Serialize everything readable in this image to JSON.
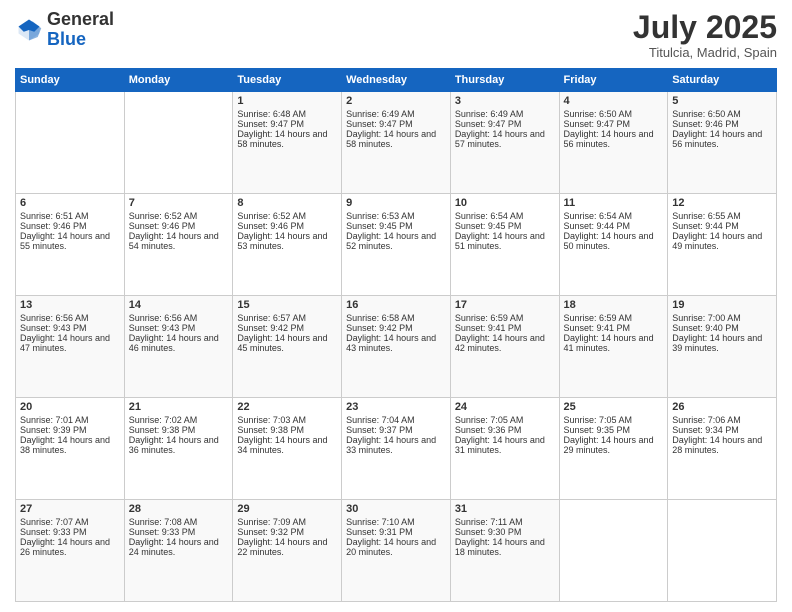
{
  "header": {
    "logo_general": "General",
    "logo_blue": "Blue",
    "month": "July 2025",
    "location": "Titulcia, Madrid, Spain"
  },
  "weekdays": [
    "Sunday",
    "Monday",
    "Tuesday",
    "Wednesday",
    "Thursday",
    "Friday",
    "Saturday"
  ],
  "weeks": [
    [
      {
        "day": "",
        "info": ""
      },
      {
        "day": "",
        "info": ""
      },
      {
        "day": "1",
        "info": "Sunrise: 6:48 AM\nSunset: 9:47 PM\nDaylight: 14 hours and 58 minutes."
      },
      {
        "day": "2",
        "info": "Sunrise: 6:49 AM\nSunset: 9:47 PM\nDaylight: 14 hours and 58 minutes."
      },
      {
        "day": "3",
        "info": "Sunrise: 6:49 AM\nSunset: 9:47 PM\nDaylight: 14 hours and 57 minutes."
      },
      {
        "day": "4",
        "info": "Sunrise: 6:50 AM\nSunset: 9:47 PM\nDaylight: 14 hours and 56 minutes."
      },
      {
        "day": "5",
        "info": "Sunrise: 6:50 AM\nSunset: 9:46 PM\nDaylight: 14 hours and 56 minutes."
      }
    ],
    [
      {
        "day": "6",
        "info": "Sunrise: 6:51 AM\nSunset: 9:46 PM\nDaylight: 14 hours and 55 minutes."
      },
      {
        "day": "7",
        "info": "Sunrise: 6:52 AM\nSunset: 9:46 PM\nDaylight: 14 hours and 54 minutes."
      },
      {
        "day": "8",
        "info": "Sunrise: 6:52 AM\nSunset: 9:46 PM\nDaylight: 14 hours and 53 minutes."
      },
      {
        "day": "9",
        "info": "Sunrise: 6:53 AM\nSunset: 9:45 PM\nDaylight: 14 hours and 52 minutes."
      },
      {
        "day": "10",
        "info": "Sunrise: 6:54 AM\nSunset: 9:45 PM\nDaylight: 14 hours and 51 minutes."
      },
      {
        "day": "11",
        "info": "Sunrise: 6:54 AM\nSunset: 9:44 PM\nDaylight: 14 hours and 50 minutes."
      },
      {
        "day": "12",
        "info": "Sunrise: 6:55 AM\nSunset: 9:44 PM\nDaylight: 14 hours and 49 minutes."
      }
    ],
    [
      {
        "day": "13",
        "info": "Sunrise: 6:56 AM\nSunset: 9:43 PM\nDaylight: 14 hours and 47 minutes."
      },
      {
        "day": "14",
        "info": "Sunrise: 6:56 AM\nSunset: 9:43 PM\nDaylight: 14 hours and 46 minutes."
      },
      {
        "day": "15",
        "info": "Sunrise: 6:57 AM\nSunset: 9:42 PM\nDaylight: 14 hours and 45 minutes."
      },
      {
        "day": "16",
        "info": "Sunrise: 6:58 AM\nSunset: 9:42 PM\nDaylight: 14 hours and 43 minutes."
      },
      {
        "day": "17",
        "info": "Sunrise: 6:59 AM\nSunset: 9:41 PM\nDaylight: 14 hours and 42 minutes."
      },
      {
        "day": "18",
        "info": "Sunrise: 6:59 AM\nSunset: 9:41 PM\nDaylight: 14 hours and 41 minutes."
      },
      {
        "day": "19",
        "info": "Sunrise: 7:00 AM\nSunset: 9:40 PM\nDaylight: 14 hours and 39 minutes."
      }
    ],
    [
      {
        "day": "20",
        "info": "Sunrise: 7:01 AM\nSunset: 9:39 PM\nDaylight: 14 hours and 38 minutes."
      },
      {
        "day": "21",
        "info": "Sunrise: 7:02 AM\nSunset: 9:38 PM\nDaylight: 14 hours and 36 minutes."
      },
      {
        "day": "22",
        "info": "Sunrise: 7:03 AM\nSunset: 9:38 PM\nDaylight: 14 hours and 34 minutes."
      },
      {
        "day": "23",
        "info": "Sunrise: 7:04 AM\nSunset: 9:37 PM\nDaylight: 14 hours and 33 minutes."
      },
      {
        "day": "24",
        "info": "Sunrise: 7:05 AM\nSunset: 9:36 PM\nDaylight: 14 hours and 31 minutes."
      },
      {
        "day": "25",
        "info": "Sunrise: 7:05 AM\nSunset: 9:35 PM\nDaylight: 14 hours and 29 minutes."
      },
      {
        "day": "26",
        "info": "Sunrise: 7:06 AM\nSunset: 9:34 PM\nDaylight: 14 hours and 28 minutes."
      }
    ],
    [
      {
        "day": "27",
        "info": "Sunrise: 7:07 AM\nSunset: 9:33 PM\nDaylight: 14 hours and 26 minutes."
      },
      {
        "day": "28",
        "info": "Sunrise: 7:08 AM\nSunset: 9:33 PM\nDaylight: 14 hours and 24 minutes."
      },
      {
        "day": "29",
        "info": "Sunrise: 7:09 AM\nSunset: 9:32 PM\nDaylight: 14 hours and 22 minutes."
      },
      {
        "day": "30",
        "info": "Sunrise: 7:10 AM\nSunset: 9:31 PM\nDaylight: 14 hours and 20 minutes."
      },
      {
        "day": "31",
        "info": "Sunrise: 7:11 AM\nSunset: 9:30 PM\nDaylight: 14 hours and 18 minutes."
      },
      {
        "day": "",
        "info": ""
      },
      {
        "day": "",
        "info": ""
      }
    ]
  ]
}
